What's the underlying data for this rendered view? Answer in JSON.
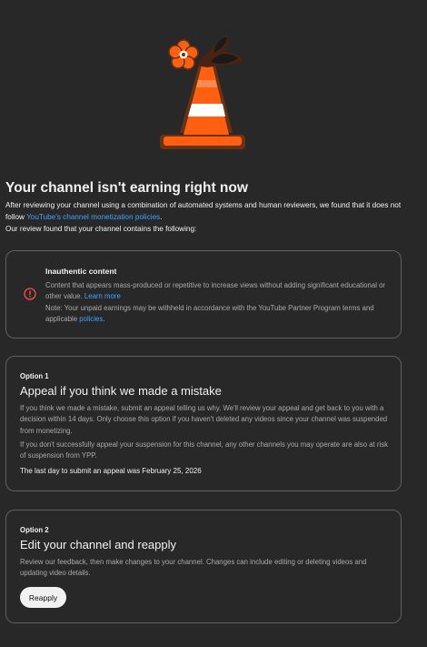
{
  "header": {
    "title": "Your channel isn't earning right now",
    "intro_text": "After reviewing your channel using a combination of automated systems and human reviewers, we found that it does not follow ",
    "intro_link": "YouTube's channel monetization policies",
    "intro_end": ".",
    "found_text": "Our review found that your channel contains the following:"
  },
  "finding": {
    "heading": "Inauthentic content",
    "description": "Content that appears mass-produced or repetitive to increase views without adding significant educational or other value. ",
    "learn_more": "Learn more",
    "note": "Note: Your unpaid earnings may be withheld in accordance with the YouTube Partner Program terms and applicable ",
    "policies_link": "policies",
    "note_end": ".",
    "icon": "warning-circle-icon",
    "icon_color": "#ff4e45"
  },
  "option1": {
    "label": "Option 1",
    "heading": "Appeal if you think we made a mistake",
    "body1": "If you think we made a mistake, submit an appeal telling us why. We'll review your appeal and get back to you with a decision within 14 days. Only choose this option if you haven't deleted any videos since your channel was suspended from monetizing.",
    "body2": "If you don't successfully appeal your suspension for this channel, any other channels you may operate are also at risk of suspension from YPP.",
    "deadline": "The last day to submit an appeal was February 25, 2026"
  },
  "option2": {
    "label": "Option 2",
    "heading": "Edit your channel and reapply",
    "body": "Review our feedback, then make changes to your channel. Changes can include editing or deleting videos and updating video details.",
    "button_label": "Reapply"
  },
  "colors": {
    "background": "#282828",
    "link": "#3ea6ff",
    "cone_orange": "#ff5f0f",
    "border": "#5f5f5f"
  }
}
